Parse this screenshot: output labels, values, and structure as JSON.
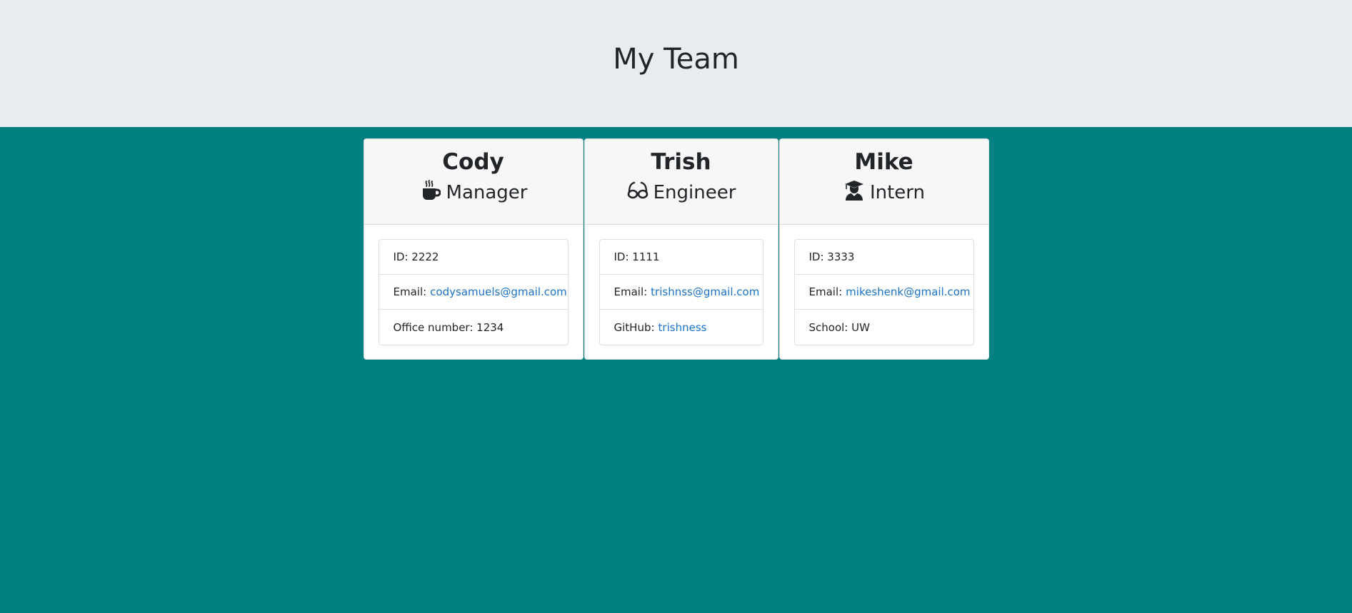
{
  "header": {
    "title": "My Team"
  },
  "employees": [
    {
      "name": "Cody",
      "role": "Manager",
      "icon": "coffee-icon",
      "id_text": "ID: 2222",
      "email_label": "Email:",
      "email": "codysamuels@gmail.com",
      "extra_label": "Office number: 1234",
      "extra_link": ""
    },
    {
      "name": "Trish",
      "role": "Engineer",
      "icon": "glasses-icon",
      "id_text": "ID: 1111",
      "email_label": "Email:",
      "email": "trishnss@gmail.com",
      "extra_label": "GitHub:",
      "extra_link": "trishness"
    },
    {
      "name": "Mike",
      "role": "Intern",
      "icon": "graduate-icon",
      "id_text": "ID: 3333",
      "email_label": "Email:",
      "email": "mikeshenk@gmail.com",
      "extra_label": "School: UW",
      "extra_link": ""
    }
  ],
  "colors": {
    "background": "#008080",
    "header_band": "#e9ecef",
    "link": "#1a73c8"
  }
}
